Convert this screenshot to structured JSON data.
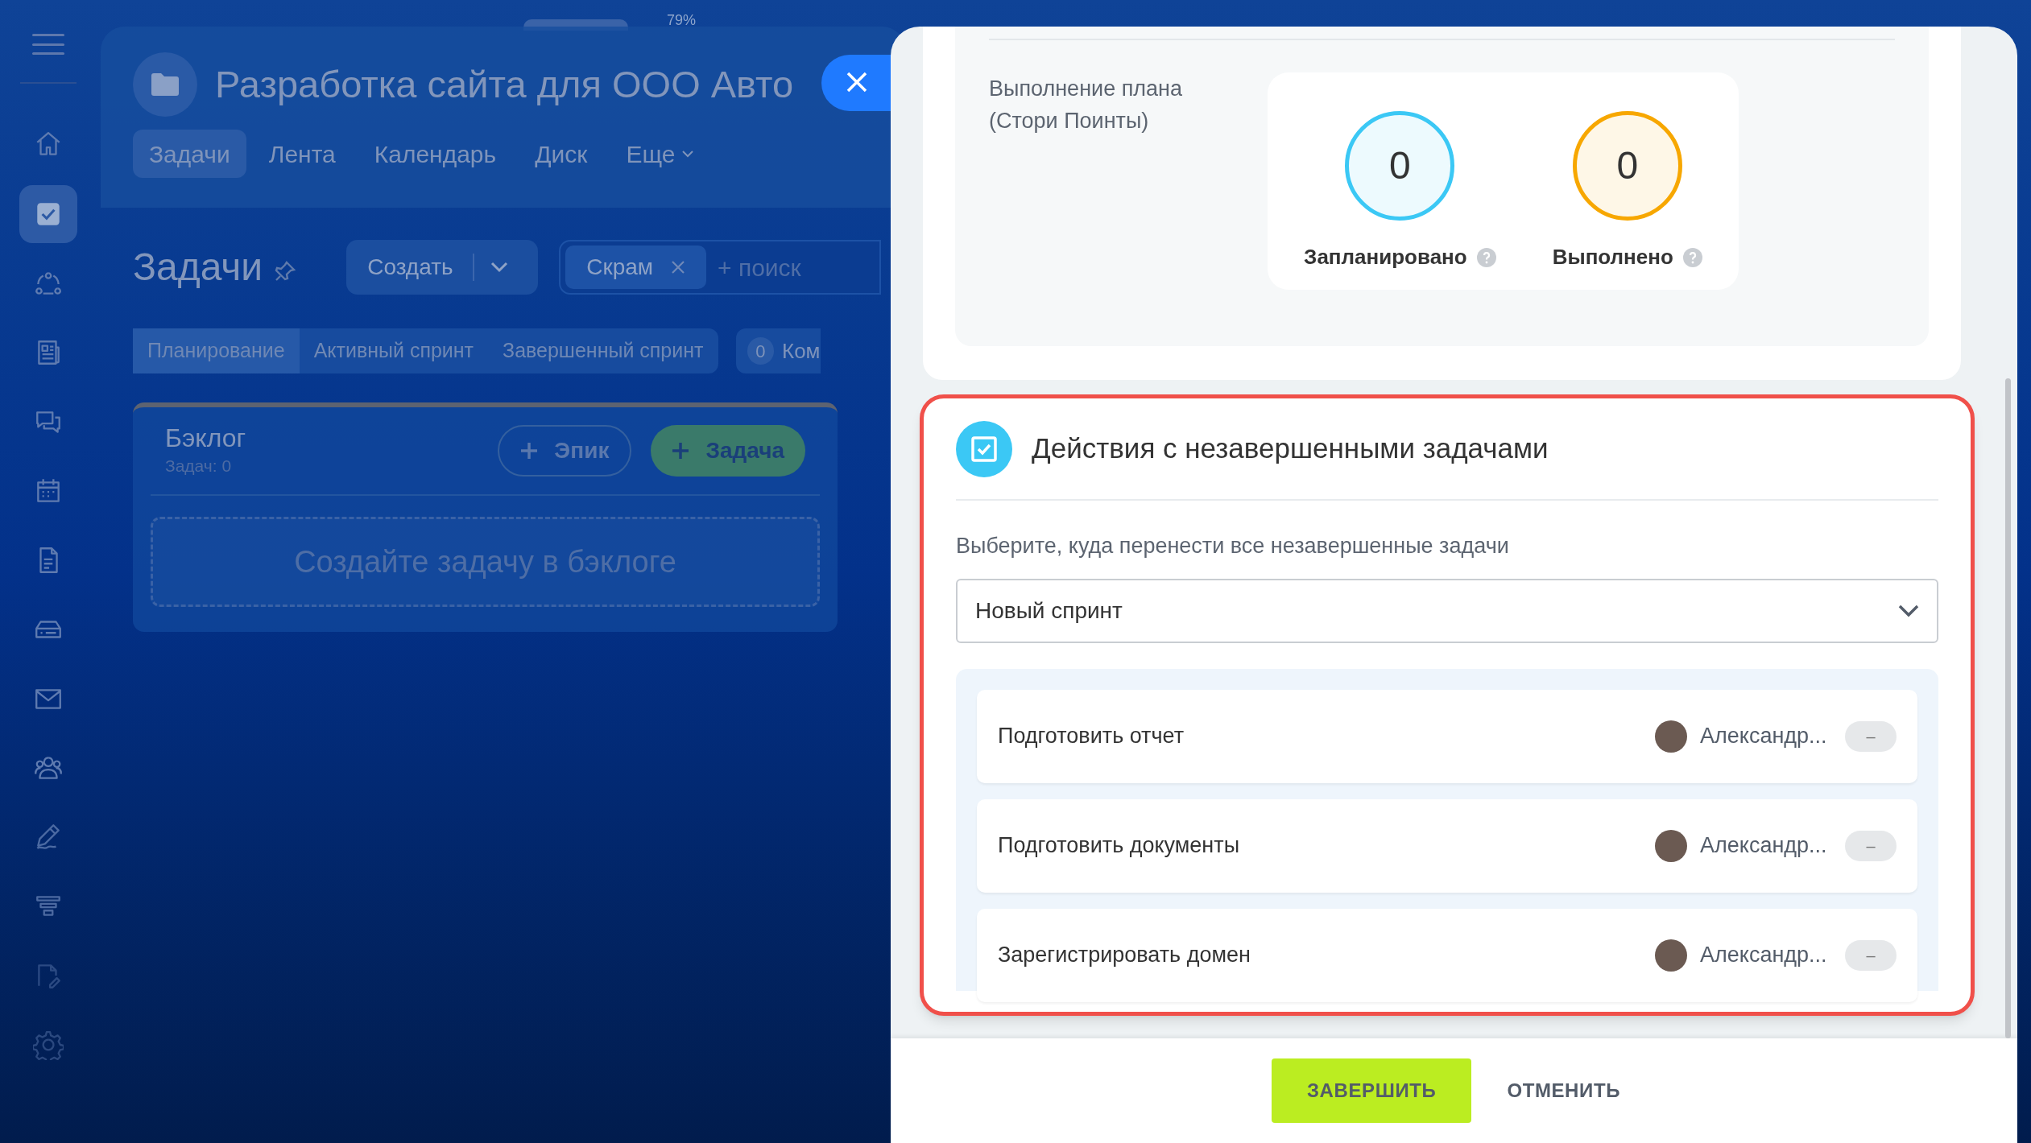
{
  "top_indicator": "79%",
  "sidebar": {
    "items": [
      {
        "kind": "home",
        "selected": false
      },
      {
        "kind": "tasks",
        "selected": true
      },
      {
        "kind": "flow",
        "selected": false
      },
      {
        "kind": "news",
        "selected": false
      },
      {
        "kind": "chat",
        "selected": false
      },
      {
        "kind": "calendar",
        "selected": false
      },
      {
        "kind": "document",
        "selected": false
      },
      {
        "kind": "drive",
        "selected": false
      },
      {
        "kind": "mail",
        "selected": false
      },
      {
        "kind": "contacts",
        "selected": false
      },
      {
        "kind": "sign",
        "selected": false
      },
      {
        "kind": "funnel",
        "selected": false
      },
      {
        "kind": "docsign",
        "selected": false
      },
      {
        "kind": "settings",
        "selected": false
      }
    ]
  },
  "project": {
    "title": "Разработка сайта для ООО Авто",
    "tabs": [
      {
        "label": "Задачи",
        "selected": true
      },
      {
        "label": "Лента",
        "selected": false
      },
      {
        "label": "Календарь",
        "selected": false
      },
      {
        "label": "Диск",
        "selected": false
      },
      {
        "label": "Еще",
        "selected": false
      }
    ]
  },
  "tasks_page": {
    "heading": "Задачи",
    "create_button": "Создать",
    "filter_tag": "Скрам",
    "search": {
      "placeholder": "+ поиск"
    },
    "sprint_tabs": [
      {
        "label": "Планирование",
        "selected": true
      },
      {
        "label": "Активный спринт",
        "selected": false
      },
      {
        "label": "Завершенный спринт",
        "selected": false
      }
    ],
    "counter": {
      "count": "0",
      "label": "Ком"
    },
    "backlog": {
      "title": "Бэклог",
      "count": "Задач: 0",
      "epic_button": "Эпик",
      "task_button": "Задача",
      "empty": "Создайте задачу в бэклоге"
    }
  },
  "panel": {
    "plan_label": "Выполнение плана (Стори Поинты)",
    "stats": [
      {
        "value": "0",
        "label": "Запланировано",
        "color": "#3bc8f5"
      },
      {
        "value": "0",
        "label": "Выполнено",
        "color": "#f7a700"
      }
    ],
    "actions": {
      "title": "Действия с незавершенными задачами",
      "prompt": "Выберите, куда перенести все незавершенные задачи",
      "select": {
        "value": "Новый спринт"
      },
      "tasks": [
        {
          "title": "Подготовить отчет",
          "assignee": "Александр...",
          "points": "–"
        },
        {
          "title": "Подготовить документы",
          "assignee": "Александр...",
          "points": "–"
        },
        {
          "title": "Зарегистрировать домен",
          "assignee": "Александр...",
          "points": "–"
        }
      ]
    },
    "buttons": {
      "finish": "ЗАВЕРШИТЬ",
      "cancel": "ОТМЕНИТЬ"
    }
  }
}
